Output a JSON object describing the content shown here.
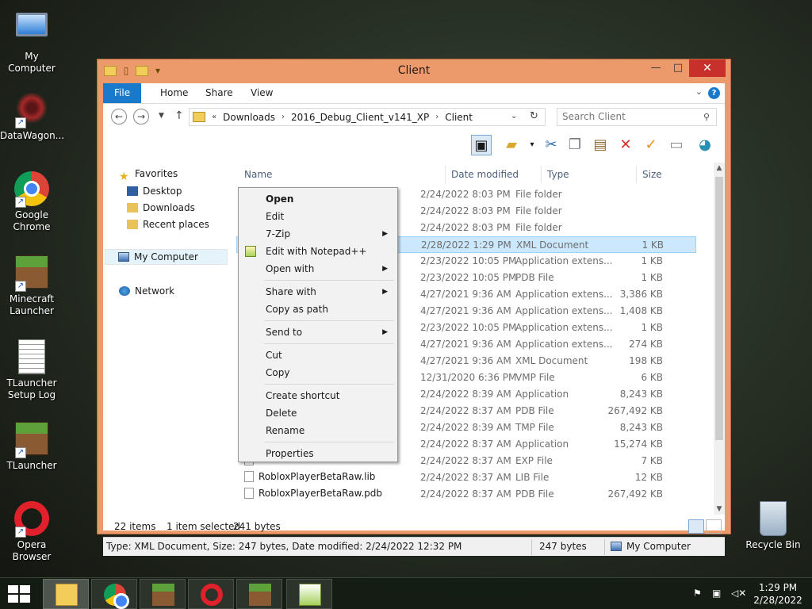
{
  "desktop": {
    "icons": [
      {
        "label": "My Computer"
      },
      {
        "label": "DataWagon..."
      },
      {
        "label": "Google Chrome"
      },
      {
        "label": "Minecraft Launcher"
      },
      {
        "label": "TLauncher Setup Log"
      },
      {
        "label": "TLauncher"
      },
      {
        "label": "Opera Browser"
      },
      {
        "label": "Recycle Bin"
      }
    ]
  },
  "window": {
    "title": "Client",
    "close_glyph": "✕",
    "min_glyph": "—",
    "max_glyph": "□"
  },
  "ribbon": {
    "tabs": [
      "File",
      "Home",
      "Share",
      "View"
    ],
    "help": "?"
  },
  "address": {
    "prefix": "«",
    "crumbs": [
      "Downloads",
      "2016_Debug_Client_v141_XP",
      "Client"
    ],
    "search_placeholder": "Search Client"
  },
  "nav": {
    "favorites": "Favorites",
    "desktop": "Desktop",
    "downloads": "Downloads",
    "recent": "Recent places",
    "computer": "My Computer",
    "network": "Network"
  },
  "columns": {
    "name": "Name",
    "date": "Date modified",
    "type": "Type",
    "size": "Size"
  },
  "files": [
    {
      "name": "",
      "date": "2/24/2022 8:03 PM",
      "type": "File folder",
      "size": "",
      "folder": true
    },
    {
      "name": "",
      "date": "2/24/2022 8:03 PM",
      "type": "File folder",
      "size": "",
      "folder": true
    },
    {
      "name": "",
      "date": "2/24/2022 8:03 PM",
      "type": "File folder",
      "size": "",
      "folder": true
    },
    {
      "name": "",
      "date": "2/28/2022 1:29 PM",
      "type": "XML Document",
      "size": "1 KB",
      "selected": true
    },
    {
      "name": "",
      "date": "2/23/2022 10:05 PM",
      "type": "Application extens...",
      "size": "1 KB"
    },
    {
      "name": "",
      "date": "2/23/2022 10:05 PM",
      "type": "PDB File",
      "size": "1 KB"
    },
    {
      "name": "",
      "date": "4/27/2021 9:36 AM",
      "type": "Application extens...",
      "size": "3,386 KB"
    },
    {
      "name": "",
      "date": "4/27/2021 9:36 AM",
      "type": "Application extens...",
      "size": "1,408 KB"
    },
    {
      "name": "",
      "date": "2/23/2022 10:05 PM",
      "type": "Application extens...",
      "size": "1 KB"
    },
    {
      "name": "",
      "date": "4/27/2021 9:36 AM",
      "type": "Application extens...",
      "size": "274 KB"
    },
    {
      "name": "",
      "date": "4/27/2021 9:36 AM",
      "type": "XML Document",
      "size": "198 KB"
    },
    {
      "name": "",
      "date": "12/31/2020 6:36 PM",
      "type": "VMP File",
      "size": "6 KB"
    },
    {
      "name": "",
      "date": "2/24/2022 8:39 AM",
      "type": "Application",
      "size": "8,243 KB"
    },
    {
      "name": "",
      "date": "2/24/2022 8:37 AM",
      "type": "PDB File",
      "size": "267,492 KB"
    },
    {
      "name": "",
      "date": "2/24/2022 8:39 AM",
      "type": "TMP File",
      "size": "8,243 KB"
    },
    {
      "name": "",
      "date": "2/24/2022 8:37 AM",
      "type": "Application",
      "size": "15,274 KB"
    },
    {
      "name": "",
      "date": "2/24/2022 8:37 AM",
      "type": "EXP File",
      "size": "7 KB"
    },
    {
      "name": "RobloxPlayerBetaRaw.lib",
      "date": "2/24/2022 8:37 AM",
      "type": "LIB File",
      "size": "12 KB"
    },
    {
      "name": "RobloxPlayerBetaRaw.pdb",
      "date": "2/24/2022 8:37 AM",
      "type": "PDB File",
      "size": "267,492 KB"
    }
  ],
  "context_menu": {
    "items": [
      {
        "label": "Open",
        "bold": true
      },
      {
        "label": "Edit"
      },
      {
        "label": "7-Zip",
        "submenu": true
      },
      {
        "label": "Edit with Notepad++",
        "icon": true
      },
      {
        "label": "Open with",
        "submenu": true
      },
      {
        "sep": true
      },
      {
        "label": "Share with",
        "submenu": true
      },
      {
        "label": "Copy as path"
      },
      {
        "sep": true
      },
      {
        "label": "Send to",
        "submenu": true
      },
      {
        "sep": true
      },
      {
        "label": "Cut"
      },
      {
        "label": "Copy"
      },
      {
        "sep": true
      },
      {
        "label": "Create shortcut"
      },
      {
        "label": "Delete"
      },
      {
        "label": "Rename"
      },
      {
        "sep": true
      },
      {
        "label": "Properties"
      }
    ]
  },
  "status": {
    "items": "22 items",
    "selected": "1 item selected",
    "bytes": "241 bytes"
  },
  "details": {
    "text": "Type: XML Document, Size: 247 bytes, Date modified: 2/24/2022 12:32 PM",
    "size": "247 bytes",
    "location": "My Computer"
  },
  "taskbar": {
    "time": "1:29 PM",
    "date": "2/28/2022"
  }
}
